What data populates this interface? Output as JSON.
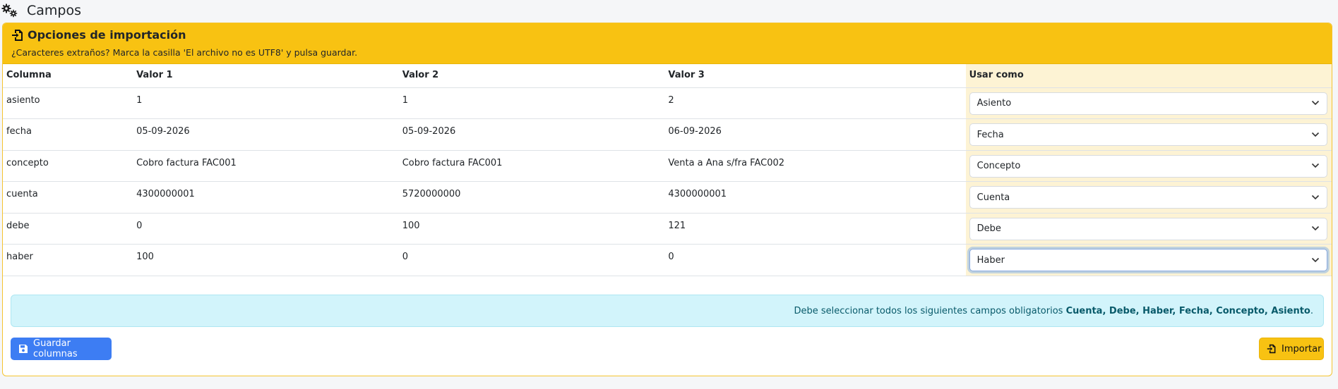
{
  "page": {
    "title": "Campos",
    "icon": "gears-icon"
  },
  "card": {
    "title": "Opciones de importación",
    "title_icon": "file-import-icon",
    "subtitle": "¿Caracteres extraños? Marca la casilla 'El archivo no es UTF8' y pulsa guardar."
  },
  "table": {
    "headers": [
      "Columna",
      "Valor 1",
      "Valor 2",
      "Valor 3",
      "Usar como"
    ],
    "rows": [
      {
        "column": "asiento",
        "v1": "1",
        "v2": "1",
        "v3": "2",
        "use_as": "Asiento"
      },
      {
        "column": "fecha",
        "v1": "05-09-2026",
        "v2": "05-09-2026",
        "v3": "06-09-2026",
        "use_as": "Fecha"
      },
      {
        "column": "concepto",
        "v1": "Cobro factura FAC001",
        "v2": "Cobro factura FAC001",
        "v3": "Venta a Ana s/fra FAC002",
        "use_as": "Concepto"
      },
      {
        "column": "cuenta",
        "v1": "4300000001",
        "v2": "5720000000",
        "v3": "4300000001",
        "use_as": "Cuenta"
      },
      {
        "column": "debe",
        "v1": "0",
        "v2": "100",
        "v3": "121",
        "use_as": "Debe"
      },
      {
        "column": "haber",
        "v1": "100",
        "v2": "0",
        "v3": "0",
        "use_as": "Haber"
      }
    ]
  },
  "alert": {
    "text": "Debe seleccionar todos los siguientes campos obligatorios",
    "fields": "Cuenta, Debe, Haber, Fecha, Concepto, Asiento",
    "end": "."
  },
  "buttons": {
    "save_label": "Guardar columnas",
    "save_icon": "save-icon",
    "import_label": "Importar",
    "import_icon": "file-import-icon"
  },
  "colors": {
    "header_bg": "#f8c212",
    "primary": "#3d7df3",
    "info_bg": "#d2f4fb",
    "use_col_bg": "#fdf3d4"
  }
}
